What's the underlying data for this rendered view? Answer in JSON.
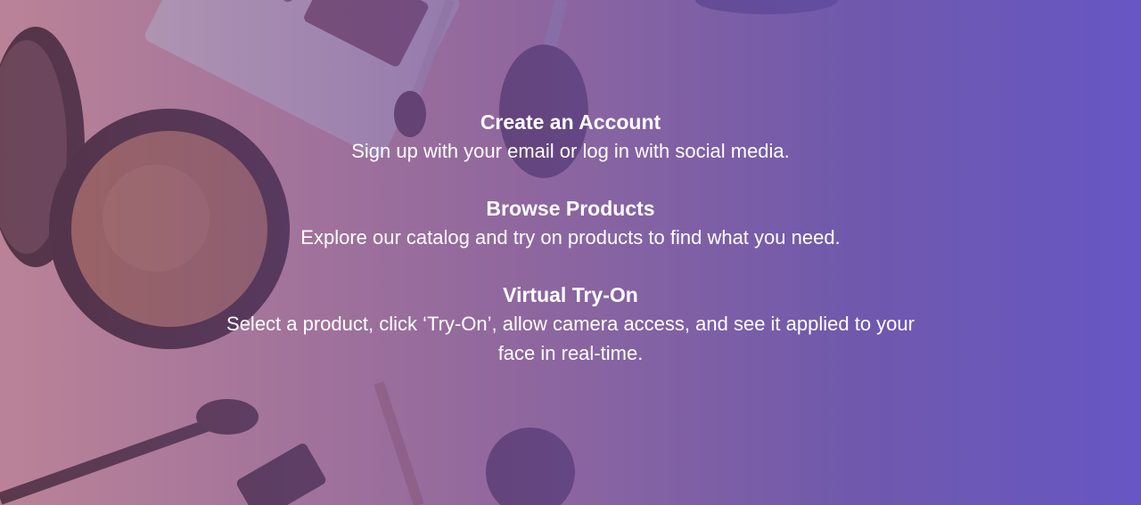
{
  "hero": {
    "steps": [
      {
        "title": "Create an Account",
        "description": "Sign up with your email or log in with social media."
      },
      {
        "title": "Browse Products",
        "description": "Explore our catalog and try on products to find what you need."
      },
      {
        "title": "Virtual Try-On",
        "description": "Select a product, click ‘Try-On’, allow camera access, and see it applied to your face in real-time."
      }
    ]
  },
  "colors": {
    "gradient_start": "#96547a",
    "gradient_end": "#6756c4",
    "text": "#ffffff"
  }
}
